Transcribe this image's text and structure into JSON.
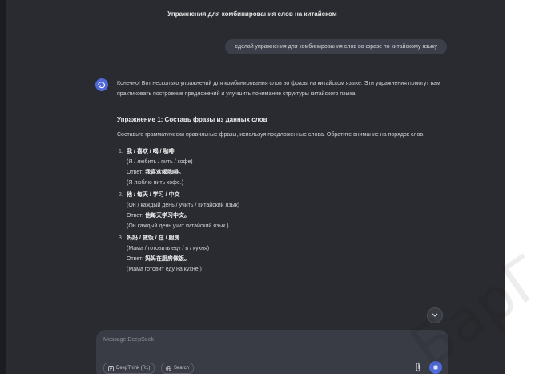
{
  "header": {
    "title": "Упражнения для комбинирования слов на китайском"
  },
  "user_message": {
    "text": "сделай упражнения для комбинирования слов во фразе по китайскому языку"
  },
  "assistant": {
    "intro": "Конечно! Вот несколько упражнений для комбинирования слов во фразы на китайском языке. Эти упражнения помогут вам практиковать построение предложений и улучшить понимание структуры китайского языка.",
    "exercise_title": "Упражнение 1: Составь фразы из данных слов",
    "exercise_desc": "Составьте грамматически правильные фразы, используя предложенные слова. Обратите внимание на порядок слов.",
    "items": [
      {
        "num": "1.",
        "words": "我 / 喜欢 / 喝 / 咖啡",
        "translation": "(Я / любить / пить / кофе)",
        "answer_label": "Ответ:",
        "answer": "我喜欢喝咖啡。",
        "answer_translation": "(Я люблю пить кофе.)"
      },
      {
        "num": "2.",
        "words": "他 / 每天 / 学习 / 中文",
        "translation": "(Он / каждый день / учить / китайский язык)",
        "answer_label": "Ответ:",
        "answer": "他每天学习中文。",
        "answer_translation": "(Он каждый день учит китайский язык.)"
      },
      {
        "num": "3.",
        "words": "妈妈 / 做饭 / 在 / 厨房",
        "translation": "(Мама / готовить еду / в / кухня)",
        "answer_label": "Ответ:",
        "answer": "妈妈在厨房做饭。",
        "answer_translation": "(Мама готовит еду на кухне.)"
      }
    ]
  },
  "composer": {
    "placeholder": "Message DeepSeek",
    "deepthink_label": "DeepThink (R1)",
    "search_label": "Search"
  },
  "watermark": {
    "text": "БарГ"
  },
  "colors": {
    "accent": "#4f6ad8",
    "background": "#2a2b30"
  }
}
